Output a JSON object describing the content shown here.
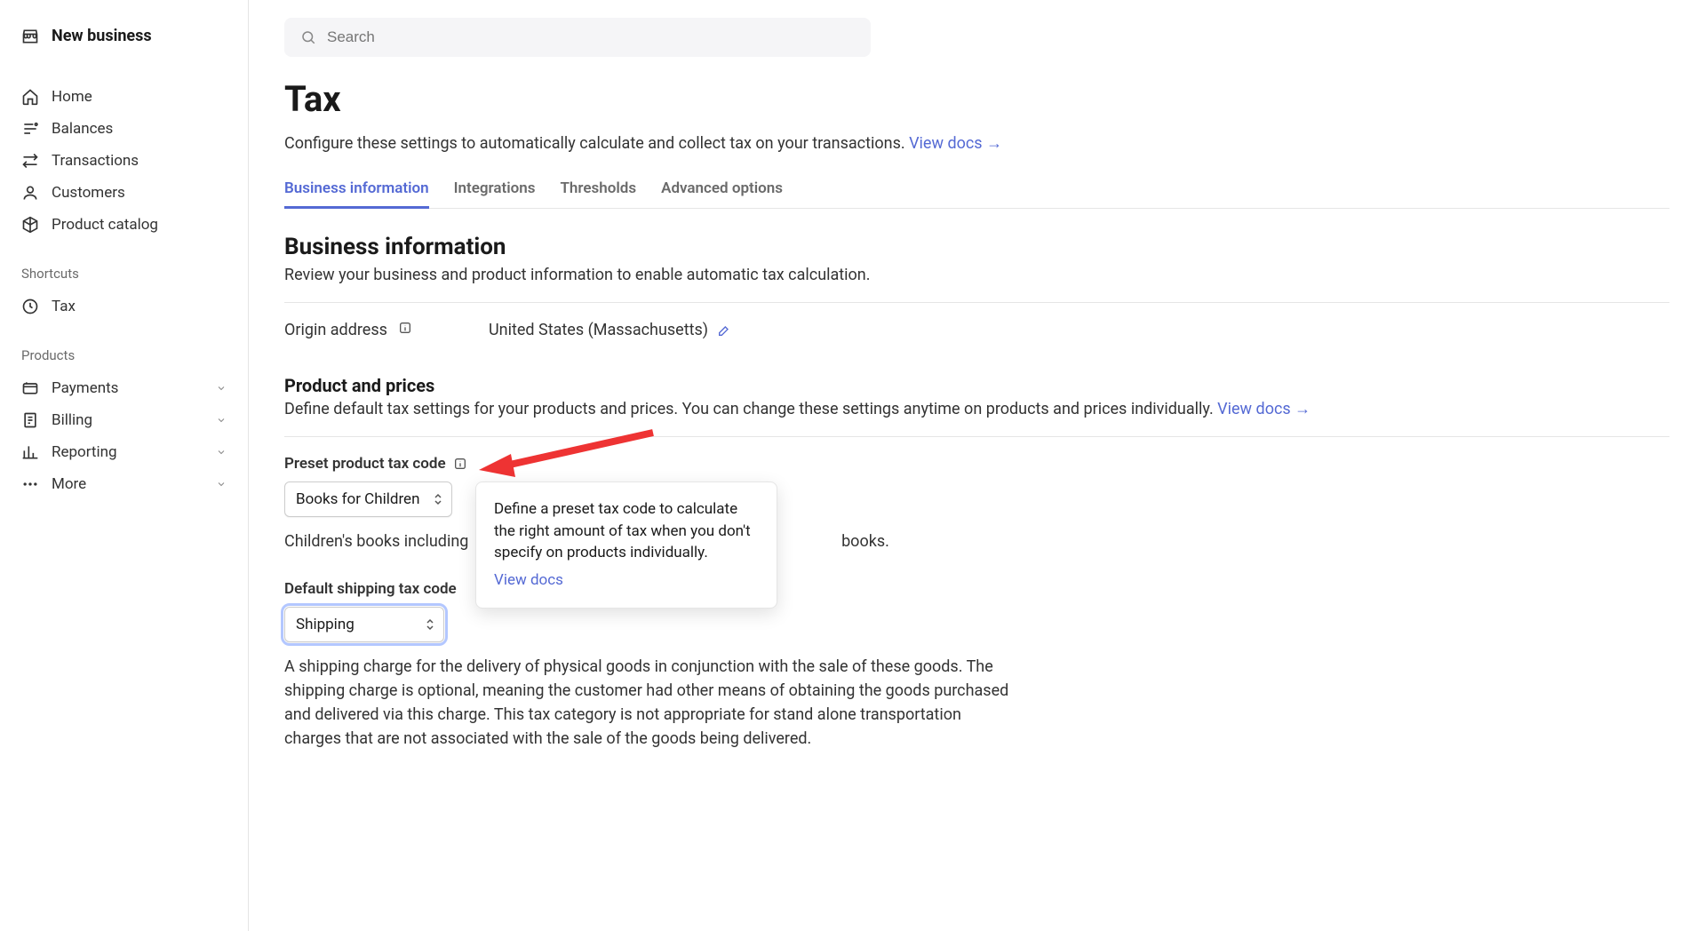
{
  "sidebar": {
    "business_name": "New business",
    "nav": {
      "home": "Home",
      "balances": "Balances",
      "transactions": "Transactions",
      "customers": "Customers",
      "product_catalog": "Product catalog"
    },
    "shortcuts_label": "Shortcuts",
    "shortcuts": {
      "tax": "Tax"
    },
    "products_label": "Products",
    "products": {
      "payments": "Payments",
      "billing": "Billing",
      "reporting": "Reporting",
      "more": "More"
    }
  },
  "search": {
    "placeholder": "Search"
  },
  "page": {
    "title": "Tax",
    "description": "Configure these settings to automatically calculate and collect tax on your transactions. ",
    "view_docs": "View docs"
  },
  "tabs": {
    "business_info": "Business information",
    "integrations": "Integrations",
    "thresholds": "Thresholds",
    "advanced": "Advanced options"
  },
  "business_info": {
    "heading": "Business information",
    "subtext": "Review your business and product information to enable automatic tax calculation.",
    "origin_label": "Origin address",
    "origin_value": "United States (Massachusetts)"
  },
  "product_prices": {
    "heading": "Product and prices",
    "subtext": "Define default tax settings for your products and prices. You can change these settings anytime on products and prices individually. ",
    "view_docs": "View docs"
  },
  "preset_tax_code": {
    "label": "Preset product tax code",
    "value": "Books for Children",
    "help": "Children's books including",
    "help_suffix": "books."
  },
  "tooltip": {
    "text": "Define a preset tax code to calculate the right amount of tax when you don't specify on products individually.",
    "link": "View docs"
  },
  "shipping_tax_code": {
    "label": "Default shipping tax code",
    "value": "Shipping",
    "help": "A shipping charge for the delivery of physical goods in conjunction with the sale of these goods. The shipping charge is optional, meaning the customer had other means of obtaining the goods purchased and delivered via this charge. This tax category is not appropriate for stand alone transportation charges that are not associated with the sale of the goods being delivered."
  }
}
